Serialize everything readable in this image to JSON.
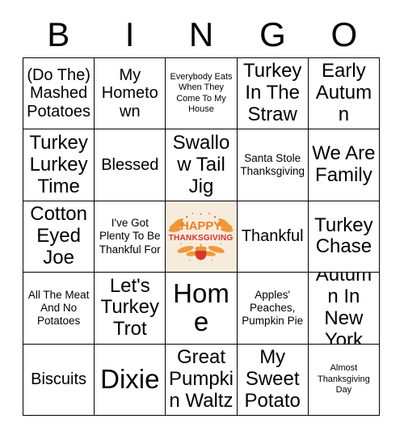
{
  "header": {
    "letters": [
      "B",
      "I",
      "N",
      "G",
      "O"
    ]
  },
  "colors": {
    "grid_line": "#000000",
    "text": "#000000",
    "page_background": "#ffffff",
    "free_space_background": "#f7ecdc",
    "free_space_happy": "#f07d24",
    "free_space_thanksgiving": "#d8342a",
    "free_space_leaf": "#f0922f",
    "free_space_acorn": "#d6392c"
  },
  "grid": {
    "rows": [
      [
        {
          "text": "(Do The) Mashed Potatoes",
          "size": "fs-l",
          "type": "text"
        },
        {
          "text": "My Hometown",
          "size": "fs-l",
          "type": "text"
        },
        {
          "text": "Everybody Eats When They Come To My House",
          "size": "fs-xs",
          "type": "text"
        },
        {
          "text": "Turkey In The Straw",
          "size": "fs-xl",
          "type": "text"
        },
        {
          "text": "Early Autumn",
          "size": "fs-xl",
          "type": "text"
        }
      ],
      [
        {
          "text": "Turkey Lurkey Time",
          "size": "fs-xl",
          "type": "text"
        },
        {
          "text": "Blessed",
          "size": "fs-l",
          "type": "text"
        },
        {
          "text": "Swallow Tail Jig",
          "size": "fs-xl",
          "type": "text"
        },
        {
          "text": "Santa Stole Thanksgiving",
          "size": "fs-s",
          "type": "text"
        },
        {
          "text": "We Are Family",
          "size": "fs-xl",
          "type": "text"
        }
      ],
      [
        {
          "text": "Cotton Eyed Joe",
          "size": "fs-xl",
          "type": "text"
        },
        {
          "text": "I've Got Plenty To Be Thankful For",
          "size": "fs-s",
          "type": "text"
        },
        {
          "text": "HAPPY THANKSGIVING",
          "size": "fs-m",
          "type": "image",
          "image_name": "happy-thanksgiving-graphic",
          "caption_top": "HAPPY",
          "caption_bottom": "THANKSGIVING"
        },
        {
          "text": "Thankful",
          "size": "fs-l",
          "type": "text"
        },
        {
          "text": "Turkey Chase",
          "size": "fs-xl",
          "type": "text"
        }
      ],
      [
        {
          "text": "All The Meat And No Potatoes",
          "size": "fs-s",
          "type": "text"
        },
        {
          "text": "Let's Turkey Trot",
          "size": "fs-xl",
          "type": "text"
        },
        {
          "text": "Home",
          "size": "fs-xxl",
          "type": "text"
        },
        {
          "text": "Apples' Peaches, Pumpkin Pie",
          "size": "fs-s",
          "type": "text"
        },
        {
          "text": "Autumn In New York",
          "size": "fs-xl",
          "type": "text"
        }
      ],
      [
        {
          "text": "Biscuits",
          "size": "fs-l",
          "type": "text"
        },
        {
          "text": "Dixie",
          "size": "fs-xxl",
          "type": "text"
        },
        {
          "text": "Great Pumpkin Waltz",
          "size": "fs-xl",
          "type": "text"
        },
        {
          "text": "My Sweet Potato",
          "size": "fs-xl",
          "type": "text"
        },
        {
          "text": "Almost Thanksgiving Day",
          "size": "fs-xs",
          "type": "text"
        }
      ]
    ]
  }
}
